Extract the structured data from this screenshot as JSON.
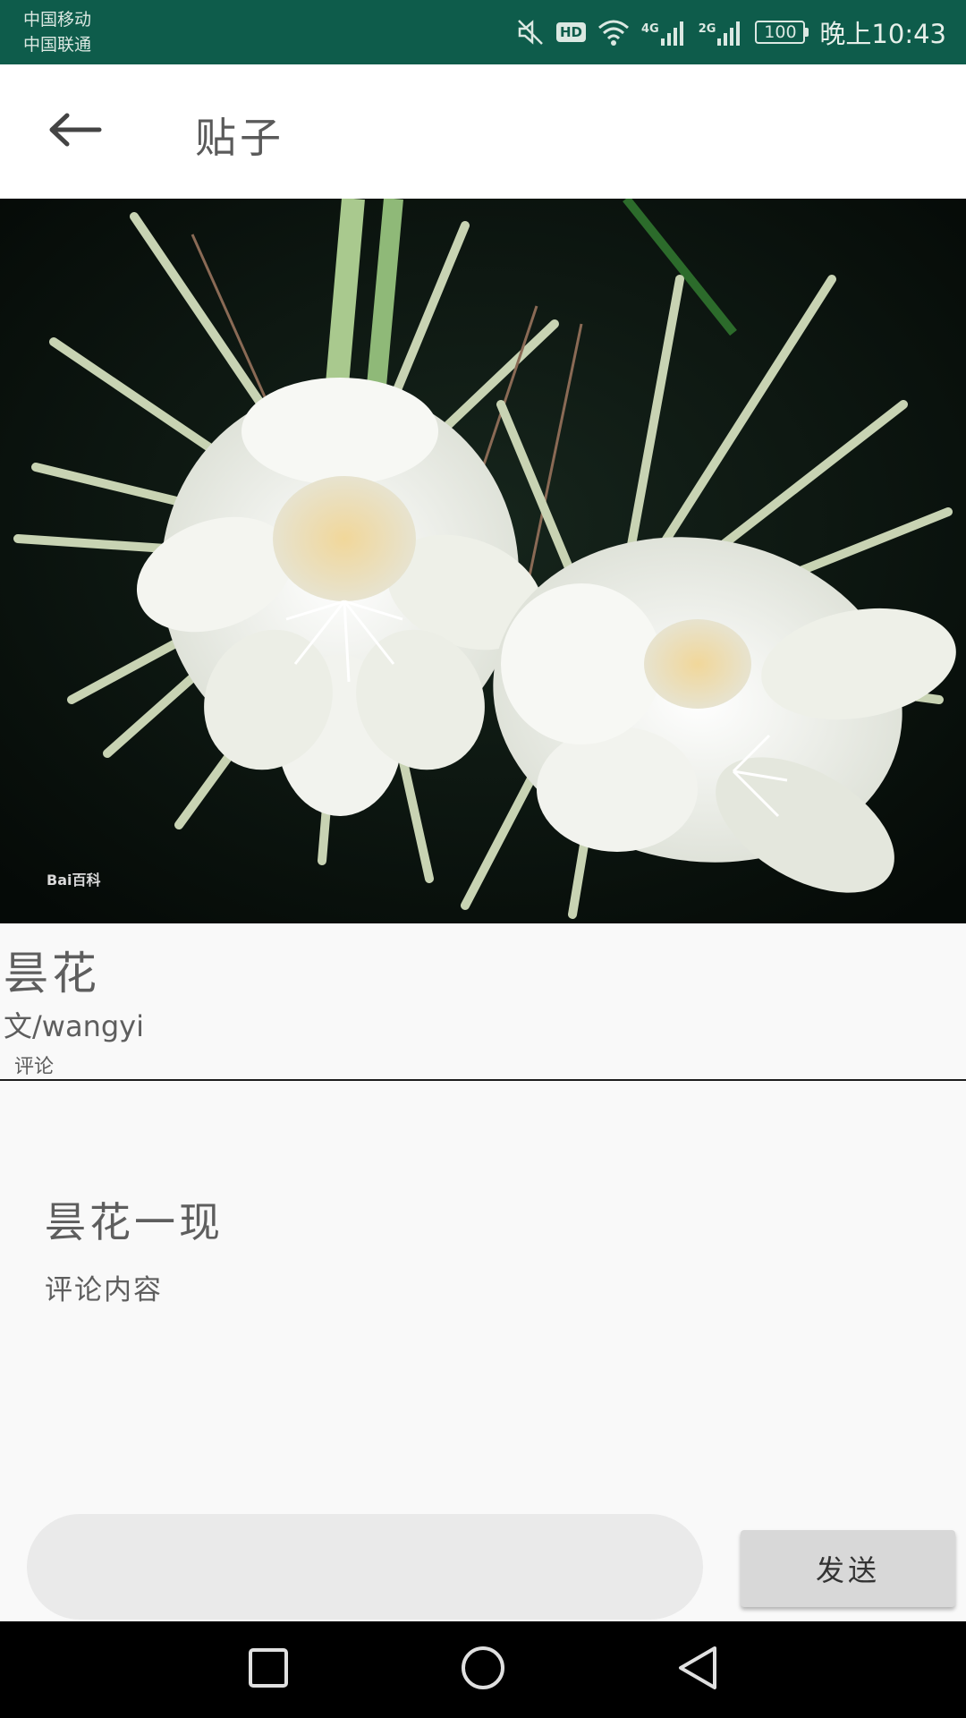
{
  "status_bar": {
    "carrier_1": "中国移动",
    "carrier_2": "中国联通",
    "signal_1_label": "4G",
    "signal_2_label": "2G",
    "hd_label": "HD",
    "battery": "100",
    "time": "晚上10:43",
    "icons": [
      "mute-icon",
      "hd-icon",
      "wifi-icon",
      "signal-4g-icon",
      "signal-2g-icon",
      "battery-icon"
    ],
    "background_color": "#0e5c4b"
  },
  "app_bar": {
    "title": "贴子",
    "back_icon": "arrow-left-icon"
  },
  "post": {
    "image_watermark": "Bai百科",
    "title": "昙花",
    "author": "文/wangyi",
    "comments_label": "评论"
  },
  "comments": [
    {
      "title": "昙花一现",
      "content": "评论内容"
    }
  ],
  "composer": {
    "input_value": "",
    "input_placeholder": "",
    "send_label": "发送"
  },
  "nav_bar": {
    "icons": [
      "recent-apps-icon",
      "home-icon",
      "back-icon"
    ]
  }
}
